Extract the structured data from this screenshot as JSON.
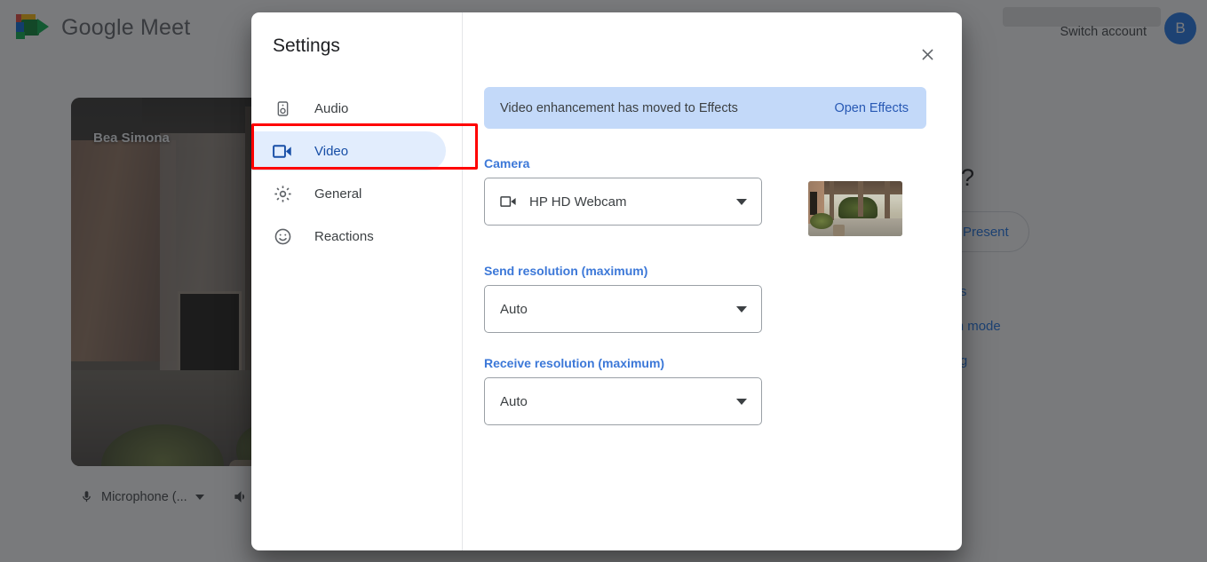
{
  "background": {
    "app_name": "Google Meet",
    "logo_icon": "google-meet-logo-icon",
    "switch_account": "Switch account",
    "avatar_initial": "B",
    "preview_name": "Bea Simona",
    "more_options_icon": "more-options-icon",
    "microphone_label": "Microphone (...",
    "microphone_icon": "microphone-icon",
    "speaker_icon": "speaker-icon",
    "ready_title": "join?",
    "present_label": "Present",
    "present_icon": "present-screen-icon",
    "link_other_options": "options",
    "link_companion_mode": "panion mode",
    "link_present_meeting": "neeting"
  },
  "dialog": {
    "title": "Settings",
    "close_icon": "close-icon",
    "nav": [
      {
        "label": "Audio",
        "icon": "speaker-icon",
        "active": false
      },
      {
        "label": "Video",
        "icon": "video-camera-icon",
        "active": true
      },
      {
        "label": "General",
        "icon": "gear-icon",
        "active": false
      },
      {
        "label": "Reactions",
        "icon": "smiley-face-icon",
        "active": false
      }
    ],
    "banner": {
      "text": "Video enhancement has moved to Effects",
      "link_label": "Open Effects"
    },
    "camera": {
      "label": "Camera",
      "value": "HP HD Webcam",
      "icon": "video-camera-icon",
      "caret_icon": "chevron-down-icon",
      "preview_thumbnail": "camera-preview-thumbnail"
    },
    "send_resolution": {
      "label": "Send resolution (maximum)",
      "value": "Auto",
      "caret_icon": "chevron-down-icon"
    },
    "receive_resolution": {
      "label": "Receive resolution (maximum)",
      "value": "Auto",
      "caret_icon": "chevron-down-icon"
    }
  },
  "colors": {
    "accent_blue": "#1a73e8",
    "active_nav_bg": "#e2edfd",
    "active_nav_text": "#174ea6",
    "banner_bg": "#c3d9f9",
    "label_blue": "#3c78d8",
    "highlight_red": "#ff0000"
  }
}
